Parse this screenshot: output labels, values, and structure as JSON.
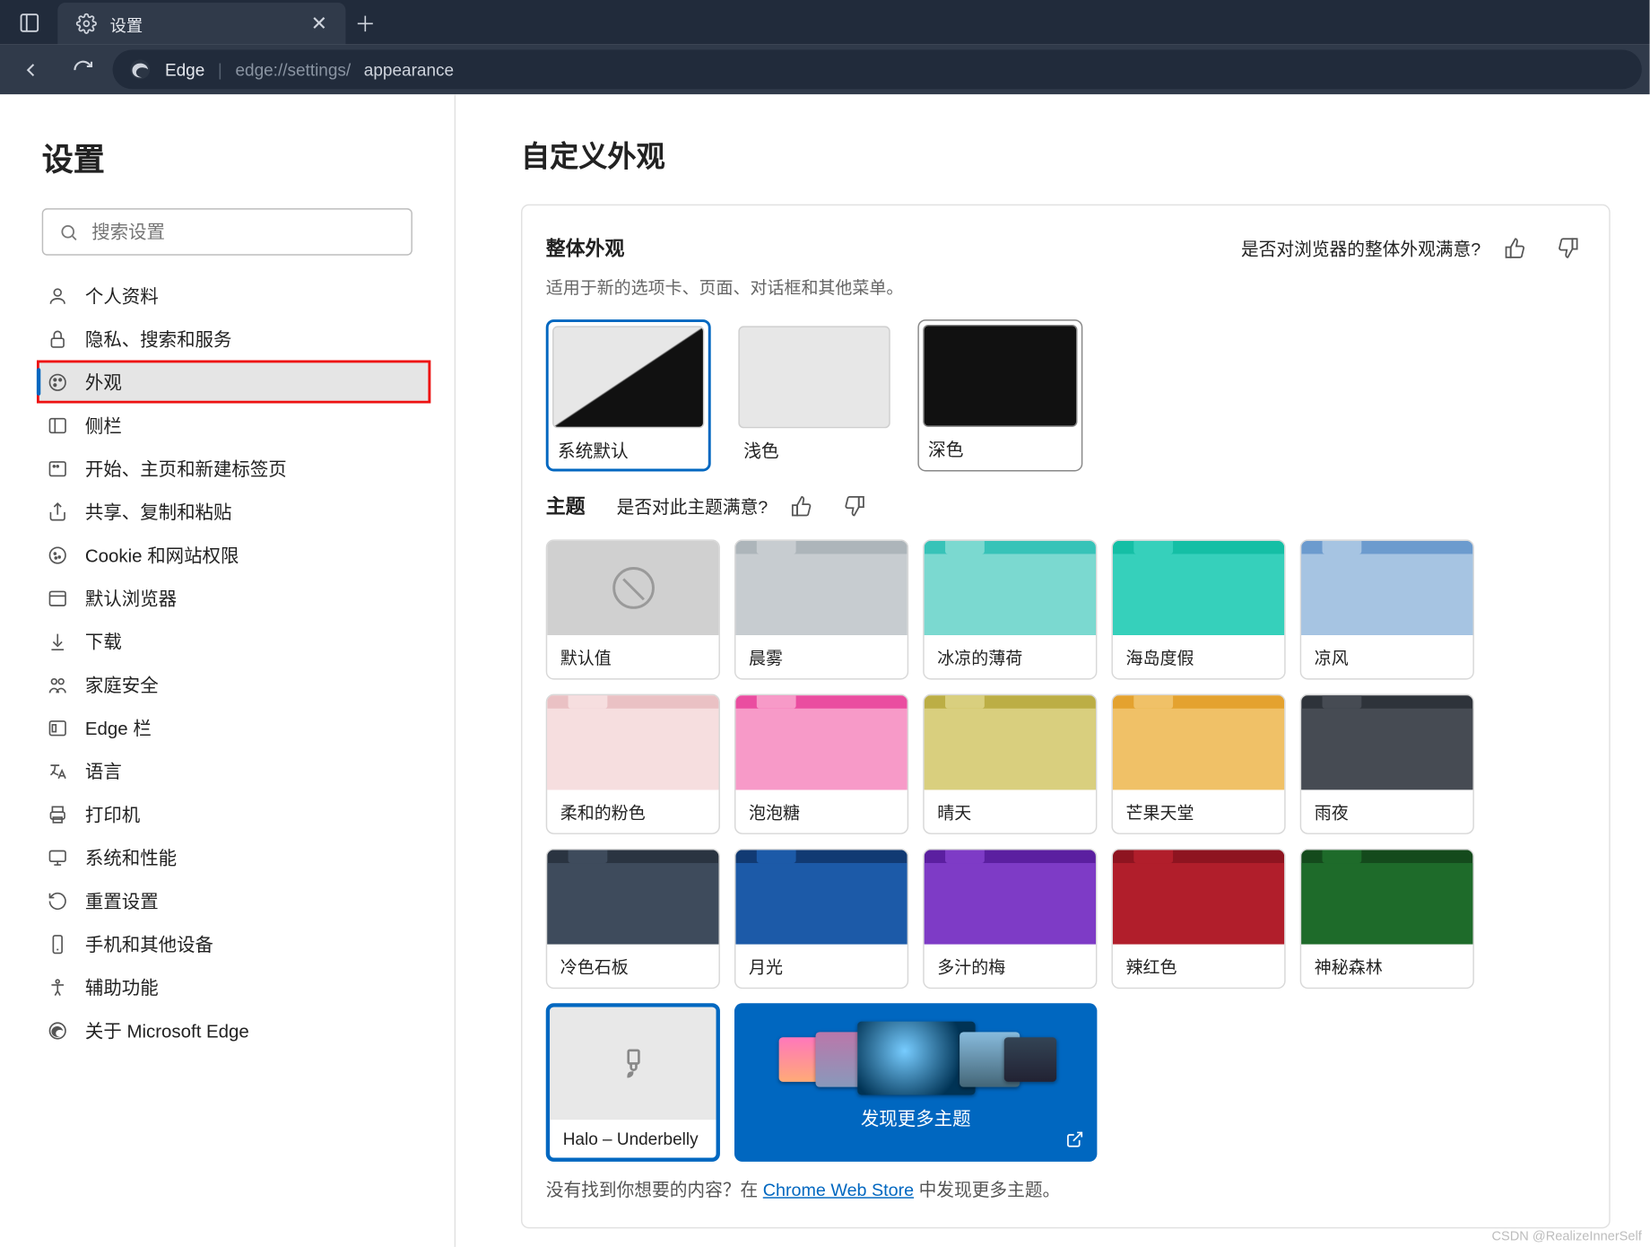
{
  "tab": {
    "title": "设置"
  },
  "address": {
    "brand": "Edge",
    "url_base": "edge://settings/",
    "url_page": "appearance"
  },
  "sidebar": {
    "title": "设置",
    "search_placeholder": "搜索设置",
    "items": [
      {
        "label": "个人资料",
        "icon": "user"
      },
      {
        "label": "隐私、搜索和服务",
        "icon": "lock"
      },
      {
        "label": "外观",
        "icon": "palette",
        "active": true,
        "highlight": true
      },
      {
        "label": "侧栏",
        "icon": "sidebar"
      },
      {
        "label": "开始、主页和新建标签页",
        "icon": "start"
      },
      {
        "label": "共享、复制和粘贴",
        "icon": "share"
      },
      {
        "label": "Cookie 和网站权限",
        "icon": "cookie"
      },
      {
        "label": "默认浏览器",
        "icon": "browser"
      },
      {
        "label": "下载",
        "icon": "download"
      },
      {
        "label": "家庭安全",
        "icon": "family"
      },
      {
        "label": "Edge 栏",
        "icon": "edgebar"
      },
      {
        "label": "语言",
        "icon": "lang"
      },
      {
        "label": "打印机",
        "icon": "printer"
      },
      {
        "label": "系统和性能",
        "icon": "system"
      },
      {
        "label": "重置设置",
        "icon": "reset"
      },
      {
        "label": "手机和其他设备",
        "icon": "phone"
      },
      {
        "label": "辅助功能",
        "icon": "a11y"
      },
      {
        "label": "关于 Microsoft Edge",
        "icon": "edge"
      }
    ]
  },
  "main": {
    "page_title": "自定义外观",
    "overall": {
      "heading": "整体外观",
      "subtitle": "适用于新的选项卡、页面、对话框和其他菜单。",
      "feedback_q": "是否对浏览器的整体外观满意?",
      "options": [
        {
          "label": "系统默认",
          "kind": "sys",
          "selected": true
        },
        {
          "label": "浅色",
          "kind": "light"
        },
        {
          "label": "深色",
          "kind": "dark"
        }
      ]
    },
    "themes": {
      "heading": "主题",
      "feedback_q": "是否对此主题满意?",
      "items": [
        {
          "label": "默认值",
          "default": true
        },
        {
          "label": "晨雾",
          "tab": "#adb5ba",
          "body": "#c7ccd0"
        },
        {
          "label": "冰凉的薄荷",
          "tab": "#37c3b8",
          "body": "#7bd9d0"
        },
        {
          "label": "海岛度假",
          "tab": "#15bfa5",
          "body": "#36d0bb"
        },
        {
          "label": "凉风",
          "tab": "#6c9bce",
          "body": "#a6c4e2"
        },
        {
          "label": "柔和的粉色",
          "tab": "#eac1c4",
          "body": "#f6dedf"
        },
        {
          "label": "泡泡糖",
          "tab": "#ea4da0",
          "body": "#f79ac8"
        },
        {
          "label": "晴天",
          "tab": "#bcae45",
          "body": "#d9cf7e"
        },
        {
          "label": "芒果天堂",
          "tab": "#e4a22f",
          "body": "#f0c167"
        },
        {
          "label": "雨夜",
          "tab": "#2e333a",
          "body": "#464b53"
        },
        {
          "label": "冷色石板",
          "tab": "#2a3441",
          "body": "#3e4b5c"
        },
        {
          "label": "月光",
          "tab": "#113a73",
          "body": "#1c5aa8"
        },
        {
          "label": "多汁的梅",
          "tab": "#5b1fa0",
          "body": "#7e3bc6"
        },
        {
          "label": "辣红色",
          "tab": "#8e1420",
          "body": "#b11e2b"
        },
        {
          "label": "神秘森林",
          "tab": "#144a1c",
          "body": "#1e6b2a"
        }
      ],
      "halo_label": "Halo – Underbelly",
      "discover_label": "发现更多主题"
    },
    "footnote": {
      "pre": "没有找到你想要的内容？在 ",
      "link": "Chrome Web Store",
      "post": " 中发现更多主题。"
    }
  },
  "watermark": "CSDN @RealizeInnerSelf"
}
